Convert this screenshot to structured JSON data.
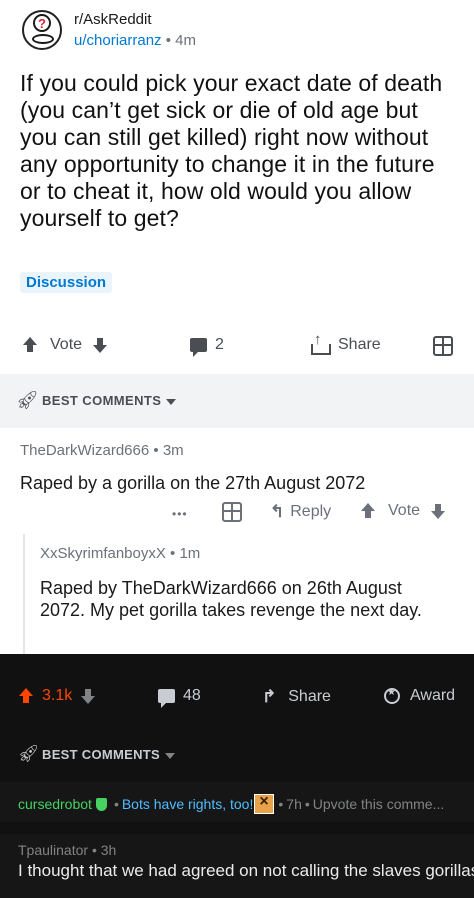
{
  "post": {
    "subreddit": "r/AskReddit",
    "author": "u/choriarranz",
    "age": "4m",
    "title": "If you could pick your exact date of death (you can’t get sick or die of old age but you can still get killed) right now without any opportunity to change it in the future or to cheat it, how old would you allow yourself to get?",
    "flair": "Discussion"
  },
  "action_bar": {
    "vote_label": "Vote",
    "comments_count": "2",
    "share_label": "Share"
  },
  "best_comments_label": "BEST COMMENTS",
  "comments": [
    {
      "author": "TheDarkWizard666",
      "age": "3m",
      "body": "Raped by a gorilla on the 27th August 2072",
      "more": "•••",
      "reply_label": "Reply",
      "vote_label": "Vote"
    },
    {
      "author": "XxSkyrimfanboyxX",
      "age": "1m",
      "body": "Raped by TheDarkWizard666 on 26th August 2072. My pet gorilla takes revenge the next day."
    }
  ],
  "dark": {
    "score": "3.1k",
    "comments_count": "48",
    "share_label": "Share",
    "award_label": "Award",
    "best_comments_label": "BEST COMMENTS",
    "bot_comment": {
      "author": "cursedrobot",
      "flair": "Bots have rights, too!",
      "age": "7h",
      "preview": "Upvote this comme..."
    },
    "comment": {
      "author": "Tpaulinator",
      "age": "3h",
      "body": "I thought that we had agreed on not calling the slaves gorillas."
    }
  },
  "colors": {
    "link_blue": "#0079d3",
    "upvote_orange": "#ff4500",
    "bot_green": "#46d160",
    "flair_blue": "#4fbcff"
  }
}
